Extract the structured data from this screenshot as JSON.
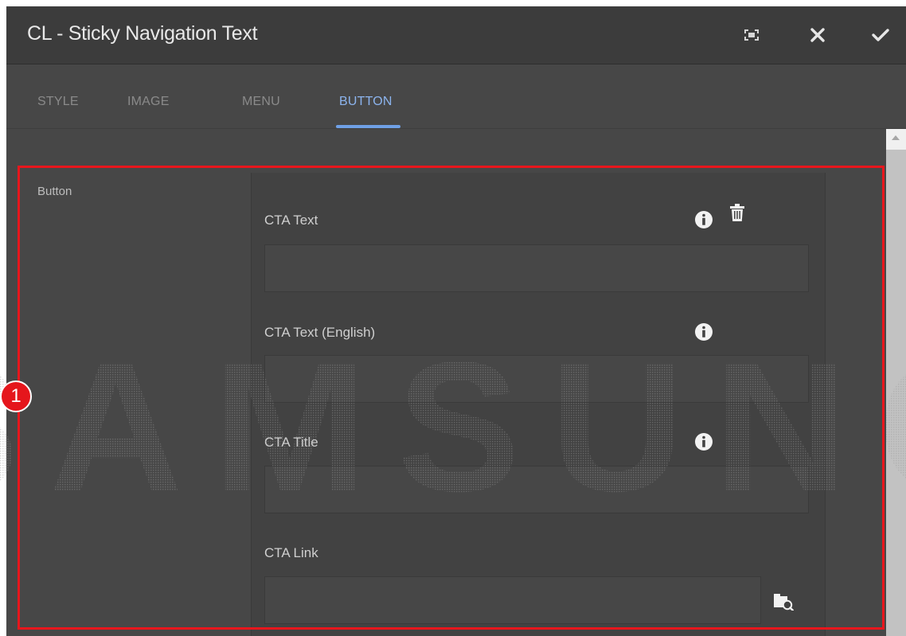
{
  "dialog": {
    "title": "CL - Sticky Navigation Text",
    "actions": {
      "fullscreen_icon": "fullscreen-icon",
      "close_icon": "close-icon",
      "confirm_icon": "check-icon"
    }
  },
  "tabs": [
    {
      "label": "STYLE",
      "active": false
    },
    {
      "label": "IMAGE",
      "active": false
    },
    {
      "label": "MENU",
      "active": false
    },
    {
      "label": "BUTTON",
      "active": true
    }
  ],
  "section": {
    "label": "Button"
  },
  "fields": [
    {
      "label": "CTA Text",
      "value": "",
      "has_info": true,
      "has_delete": true
    },
    {
      "label": "CTA Text (English)",
      "value": "",
      "has_info": true
    },
    {
      "label": "CTA Title",
      "value": "",
      "has_info": true
    },
    {
      "label": "CTA Link",
      "value": "",
      "has_browse": true
    }
  ],
  "watermark": {
    "text": "SAMSUNG"
  },
  "annotation": {
    "marker": "1",
    "color": "#e5161c"
  },
  "colors": {
    "accent": "#6fa0e6",
    "background": "#4b4b4b"
  }
}
